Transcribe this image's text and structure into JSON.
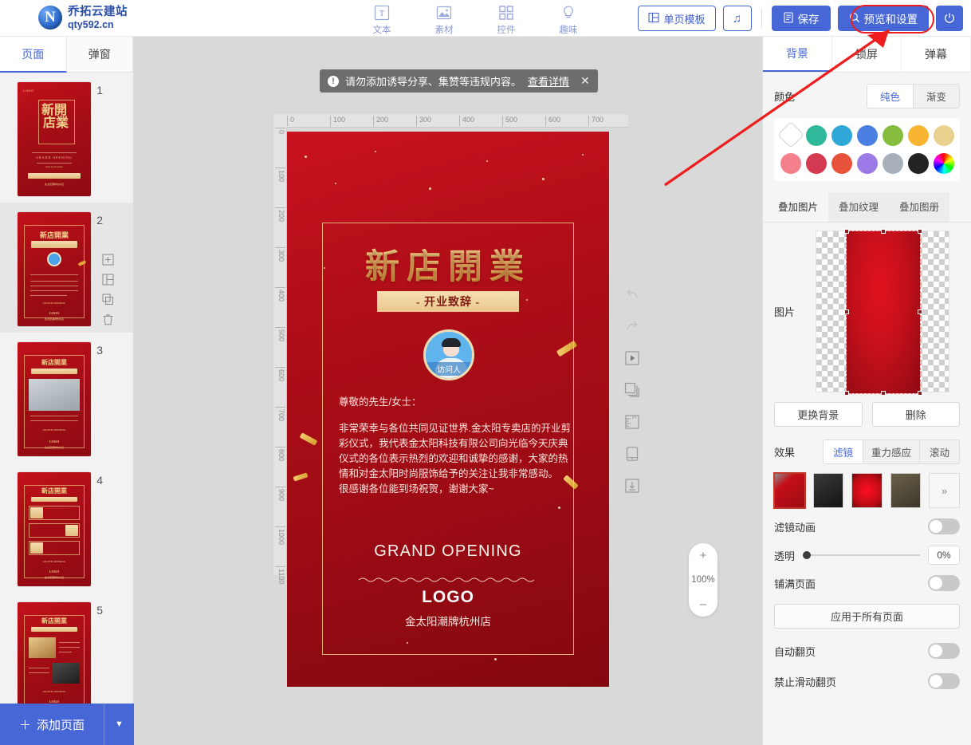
{
  "brand": {
    "name": "乔拓云建站",
    "domain": "qty592.cn",
    "mark": "N"
  },
  "topbar": {
    "tools": [
      {
        "label": "文本",
        "icon": "text-icon"
      },
      {
        "label": "素材",
        "icon": "image-icon"
      },
      {
        "label": "控件",
        "icon": "widget-icon"
      },
      {
        "label": "趣味",
        "icon": "bulb-icon"
      }
    ],
    "single_page_template": "单页模板",
    "music_icon": "♫",
    "save": "保存",
    "preview_settings": "预览和设置",
    "power_icon": "⏻"
  },
  "left_panel": {
    "tabs": [
      {
        "label": "页面",
        "active": true
      },
      {
        "label": "弹窗",
        "active": false
      }
    ],
    "pages": [
      {
        "num": "1",
        "selected": false
      },
      {
        "num": "2",
        "selected": true
      },
      {
        "num": "3",
        "selected": false
      },
      {
        "num": "4",
        "selected": false
      },
      {
        "num": "5",
        "selected": false
      }
    ],
    "page_actions": [
      "add-page-icon",
      "layout-icon",
      "copy-icon",
      "delete-icon"
    ],
    "add_page": "添加页面",
    "add_page_caret": "▼"
  },
  "canvas": {
    "warning": {
      "text": "请勿添加诱导分享、集赞等违规内容。",
      "link": "查看详情",
      "close": "✕"
    },
    "ruler_h": [
      "0",
      "100",
      "200",
      "300",
      "400",
      "500",
      "600",
      "700"
    ],
    "ruler_v": [
      "0",
      "100",
      "200",
      "300",
      "400",
      "500",
      "600",
      "700",
      "800",
      "900",
      "1000",
      "1100"
    ],
    "zoom": {
      "plus": "+",
      "value": "100%",
      "minus": "–"
    },
    "tools": [
      "undo-icon",
      "redo-icon",
      "play-icon",
      "layers-icon",
      "ruler-icon",
      "phone-preview-icon",
      "download-icon"
    ],
    "poster": {
      "title": "新店開業",
      "subtitle": "- 开业致辞 -",
      "avatar_tag": "访问人",
      "greeting": "尊敬的先生/女士：",
      "body": "非常荣幸与各位共同见证世界.金太阳专卖店的开业剪彩仪式，我代表金太阳科技有限公司向光临今天庆典仪式的各位表示热烈的欢迎和诚挚的感谢，大家的热情和对金太阳时尚服饰给予的关注让我非常感动。",
      "body2": "很感谢各位能到场祝贺，谢谢大家~",
      "grand_opening": "GRAND OPENING",
      "logo": "LOGO",
      "shop": "金太阳潮牌杭州店"
    }
  },
  "right_panel": {
    "tabs": [
      {
        "label": "背景",
        "active": true
      },
      {
        "label": "锁屏",
        "active": false
      },
      {
        "label": "弹幕",
        "active": false
      }
    ],
    "color_label": "颜色",
    "color_modes": [
      {
        "label": "纯色",
        "on": true
      },
      {
        "label": "渐变",
        "on": false
      }
    ],
    "swatches": [
      "#ffffff",
      "#2fb99a",
      "#2fa8d8",
      "#4a7ee0",
      "#86bd3e",
      "#f7b531",
      "#e8d08e",
      "#f4808d",
      "#d53a53",
      "#e8523a",
      "#9b7ae6",
      "#a8b0bc",
      "#232323",
      "color-wheel"
    ],
    "overlay_tabs": [
      {
        "label": "叠加图片",
        "on": true
      },
      {
        "label": "叠加纹理",
        "on": false
      },
      {
        "label": "叠加图册",
        "on": false
      }
    ],
    "image_label": "图片",
    "replace_bg": "更换背景",
    "delete": "删除",
    "effect_label": "效果",
    "effect_modes": [
      {
        "label": "滤镜",
        "on": true
      },
      {
        "label": "重力感应",
        "on": false
      },
      {
        "label": "滚动",
        "on": false
      }
    ],
    "filters": [
      {
        "color": "#c50f19",
        "selected": true
      },
      {
        "color": "#2b2b2b",
        "selected": false
      },
      {
        "color": "#e4121e",
        "selected": false
      },
      {
        "color": "#514a32",
        "selected": false
      }
    ],
    "filter_more": "»",
    "filter_anim": {
      "label": "滤镜动画",
      "on": false
    },
    "transparency": {
      "label": "透明",
      "value": "0%"
    },
    "fill_page": {
      "label": "铺满页面",
      "on": false
    },
    "apply_all": "应用于所有页面",
    "auto_flip": {
      "label": "自动翻页",
      "on": false
    },
    "disable_swipe": {
      "label": "禁止滑动翻页",
      "on": false
    }
  }
}
